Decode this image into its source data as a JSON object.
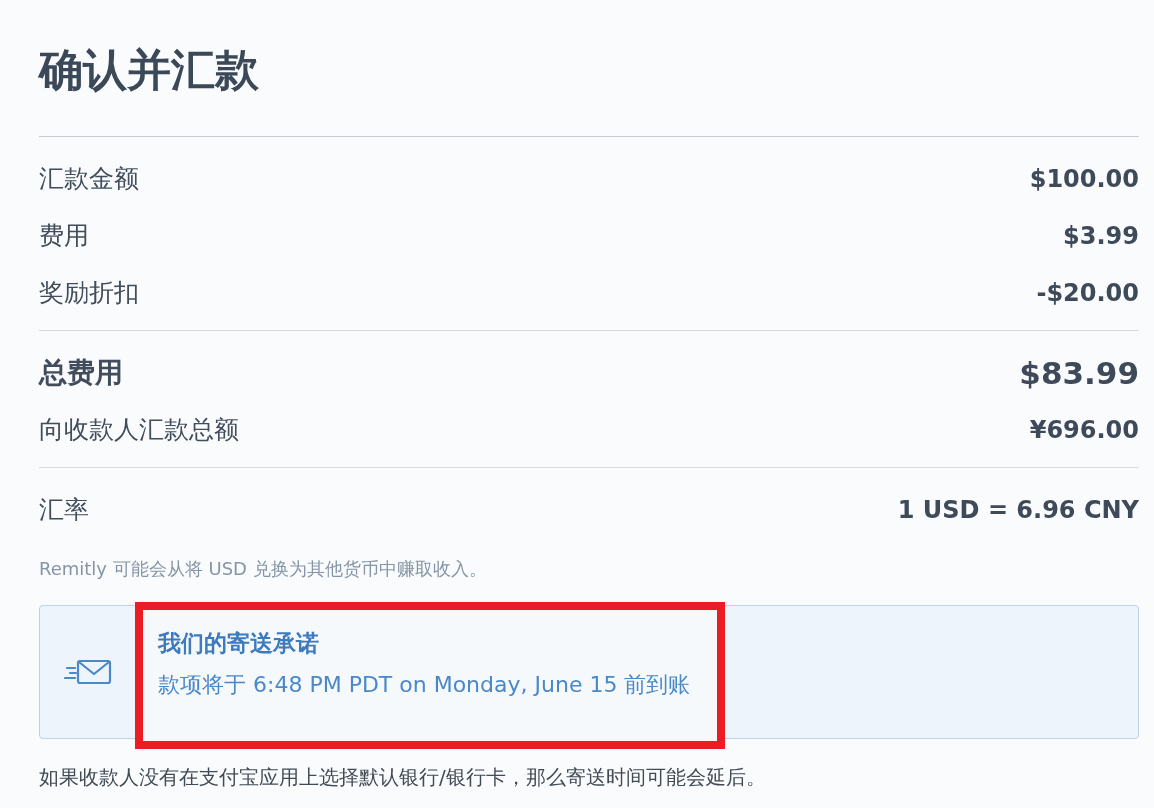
{
  "title": "确认并汇款",
  "sections": [
    {
      "rows": [
        {
          "label": "汇款金额",
          "value": "$100.00",
          "kind": "plain"
        },
        {
          "label": "费用",
          "value": "$3.99",
          "kind": "plain"
        },
        {
          "label": "奖励折扣",
          "value": "-$20.00",
          "kind": "plain"
        }
      ]
    },
    {
      "rows": [
        {
          "label": "总费用",
          "value": "$83.99",
          "kind": "total"
        },
        {
          "label": "向收款人汇款总额",
          "value": "¥696.00",
          "kind": "plain"
        }
      ]
    },
    {
      "rows": [
        {
          "label": "汇率",
          "value": "1 USD = 6.96 CNY",
          "kind": "plain"
        }
      ],
      "note": "Remitly 可能会从将 USD 兑换为其他货币中赚取收入。"
    }
  ],
  "delivery_promise": {
    "title": "我们的寄送承诺",
    "text": "款项将于 6:48 PM PDT on Monday, June 15 前到账",
    "highlighted": true
  },
  "footnote": "如果收款人没有在支付宝应用上选择默认银行/银行卡，那么寄送时间可能会延后。"
}
